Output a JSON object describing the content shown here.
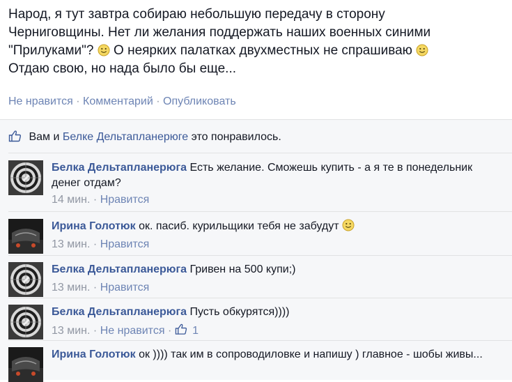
{
  "post": {
    "line1": "Народ, я тут завтра собираю небольшую передачу в сторону",
    "line2": "Черниговщины. Нет ли желания поддержать наших военных синими",
    "line3a": "\"Прилуками\"?",
    "line3b": "О неярких палатках двухместных не спрашиваю",
    "line4": "Отдаю свою, но нада было бы еще..."
  },
  "actions": {
    "unlike": "Не нравится",
    "sep": "·",
    "comment": "Комментарий",
    "share": "Опубликовать"
  },
  "likes": {
    "prefix": "Вам и",
    "name": "Белке Дельтапланерюге",
    "suffix": "это понравилось."
  },
  "comments": [
    {
      "author": "Белка Дельтапланерюга",
      "text": "Есть желание. Сможешь купить - а я те в понедельник денег отдам?",
      "time": "14 мин.",
      "action": "Нравится"
    },
    {
      "author": "Ирина Голотюк",
      "text": "ок. пасиб. курильщики тебя не забудут",
      "time": "13 мин.",
      "action": "Нравится"
    },
    {
      "author": "Белка Дельтапланерюга",
      "text": "Гривен на 500 купи;)",
      "time": "13 мин.",
      "action": "Нравится"
    },
    {
      "author": "Белка Дельтапланерюга",
      "text": "Пусть обкурятся))))",
      "time": "13 мин.",
      "action": "Не нравится",
      "like_count": "1"
    },
    {
      "author": "Ирина Голотюк",
      "text": "ок )))) так им в сопроводиловке и напишу ) главное - шобы живы...",
      "time": "",
      "action": ""
    }
  ],
  "icons": {
    "emoji": "smiley-icon",
    "like": "thumbs-up-icon"
  },
  "colors": {
    "link": "#3b5998",
    "action_link": "#6d84b4",
    "muted": "#9197a3",
    "feedback_bg": "#f6f7f9"
  }
}
